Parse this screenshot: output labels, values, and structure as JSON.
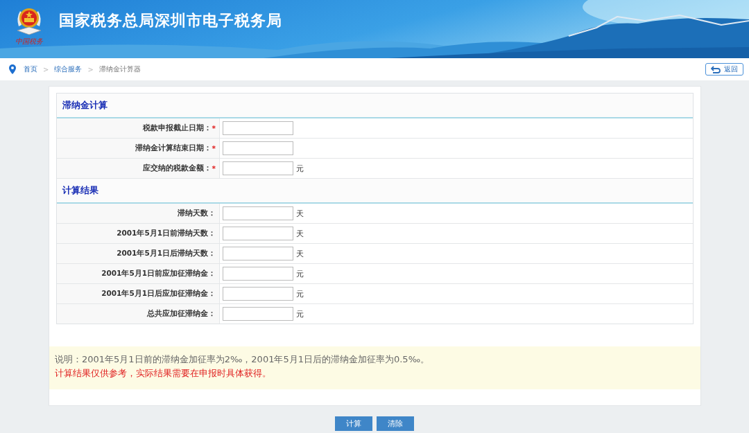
{
  "header": {
    "title": "国家税务总局深圳市电子税务局",
    "emblem_caption": "中国税务"
  },
  "breadcrumb": {
    "items": [
      {
        "label": "首页",
        "kind": "link"
      },
      {
        "label": "综合服务",
        "kind": "link"
      },
      {
        "label": "滞纳金计算器",
        "kind": "current"
      }
    ],
    "separator": ">",
    "back_button": "返回"
  },
  "sections": [
    {
      "title": "滞纳金计算",
      "rows": [
        {
          "label": "税款申报截止日期：",
          "mark": "*"
        },
        {
          "label": "滞纳金计算结束日期：",
          "mark": "*"
        },
        {
          "label": "应交纳的税款金额：",
          "mark": "*",
          "unit": "元"
        }
      ]
    },
    {
      "title": "计算结果",
      "rows": [
        {
          "label": "滞纳天数：",
          "unit": "天"
        },
        {
          "label": "2001年5月1日前滞纳天数：",
          "unit": "天"
        },
        {
          "label": "2001年5月1日后滞纳天数：",
          "unit": "天"
        },
        {
          "label": "2001年5月1日前应加征滞纳金：",
          "unit": "元"
        },
        {
          "label": "2001年5月1日后应加征滞纳金：",
          "unit": "元"
        },
        {
          "label": "总共应加征滞纳金：",
          "unit": "元"
        }
      ]
    }
  ],
  "notes": [
    {
      "text": "说明：2001年5月1日前的滞纳金加征率为2‰，2001年5月1日后的滞纳金加征率为0.5‰。",
      "kind": "info"
    },
    {
      "text": "计算结果仅供参考，实际结果需要在申报时具体获得。",
      "kind": "warning"
    }
  ],
  "buttons": [
    "计算",
    "清除"
  ]
}
